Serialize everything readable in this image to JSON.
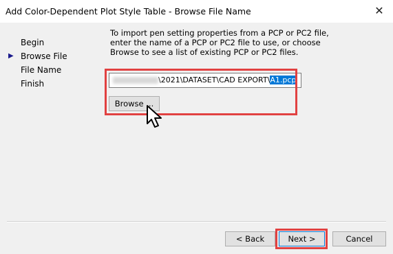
{
  "window": {
    "title": "Add Color-Dependent Plot Style Table - Browse File Name",
    "close_glyph": "✕"
  },
  "steps": [
    {
      "label": "Begin",
      "current": false
    },
    {
      "label": "Browse File",
      "current": true
    },
    {
      "label": "File Name",
      "current": false
    },
    {
      "label": "Finish",
      "current": false
    }
  ],
  "instructions": "To import pen setting properties from a PCP or PC2 file, enter the name of a PCP or PC2 file to use, or choose Browse to see a list of existing PCP or PC2 files.",
  "file_path": {
    "visible_path": "\\2021\\DATASET\\CAD EXPORT\\",
    "selected_file": "A1.pcp"
  },
  "buttons": {
    "browse": "Browse ...",
    "back": "< Back",
    "next": "Next >",
    "cancel": "Cancel"
  },
  "colors": {
    "highlight": "#e14141",
    "selection": "#0078d7"
  }
}
